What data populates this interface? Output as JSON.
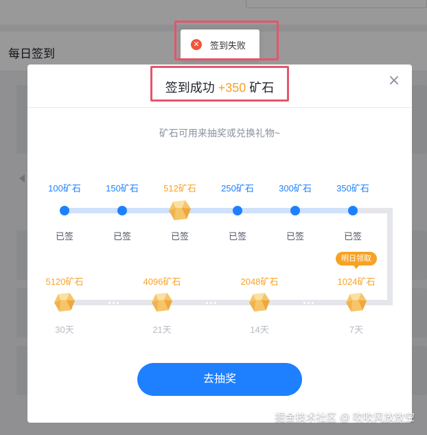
{
  "background": {
    "page_title": "每日签到"
  },
  "toast": {
    "icon": "error-circle-icon",
    "text": "签到失败"
  },
  "modal": {
    "title_prefix": "签到成功",
    "title_points": "+350",
    "title_suffix": "矿石",
    "close_icon": "close-icon",
    "subtitle": "矿石可用来抽奖或兑换礼物~",
    "row1": [
      {
        "amount": "100矿石",
        "status": "已签"
      },
      {
        "amount": "150矿石",
        "status": "已签"
      },
      {
        "amount": "512矿石",
        "status": "已签"
      },
      {
        "amount": "250矿石",
        "status": "已签"
      },
      {
        "amount": "300矿石",
        "status": "已签"
      },
      {
        "amount": "350矿石",
        "status": "已签"
      }
    ],
    "row2": [
      {
        "amount": "5120矿石",
        "days": "30天"
      },
      {
        "amount": "4096矿石",
        "days": "21天"
      },
      {
        "amount": "2048矿石",
        "days": "14天"
      },
      {
        "amount": "1024矿石",
        "days": "7天"
      }
    ],
    "tomorrow_badge": "明日领取",
    "draw_button": "去抽奖"
  },
  "watermark": "掘金技术社区 @ 吹吹风放放空",
  "colors": {
    "primary": "#1e80ff",
    "accent": "#f7a224",
    "error": "#f0553c",
    "highlight": "#e6546a"
  }
}
